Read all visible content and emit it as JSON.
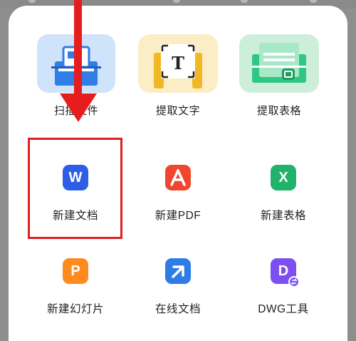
{
  "tools_top": [
    {
      "label": "扫描文件",
      "icon": "scan-document-icon"
    },
    {
      "label": "提取文字",
      "icon": "extract-text-icon",
      "glyph": "T"
    },
    {
      "label": "提取表格",
      "icon": "extract-table-icon"
    }
  ],
  "create_items": [
    {
      "label": "新建文档",
      "icon": "word-icon",
      "glyph": "W",
      "color": "#2f5ee6"
    },
    {
      "label": "新建PDF",
      "icon": "pdf-icon",
      "glyph": "A",
      "color": "#f0462e"
    },
    {
      "label": "新建表格",
      "icon": "excel-icon",
      "glyph": "X",
      "color": "#1fb36b"
    },
    {
      "label": "新建幻灯片",
      "icon": "ppt-icon",
      "glyph": "P",
      "color": "#ff8a1f"
    },
    {
      "label": "在线文档",
      "icon": "online-doc-icon",
      "glyph": "⤴",
      "color": "#2f7ce6"
    },
    {
      "label": "DWG工具",
      "icon": "dwg-icon",
      "glyph": "D",
      "color": "#7d4ff0"
    }
  ],
  "colors": {
    "highlight": "#e02020",
    "arrow": "#e51d1d"
  }
}
